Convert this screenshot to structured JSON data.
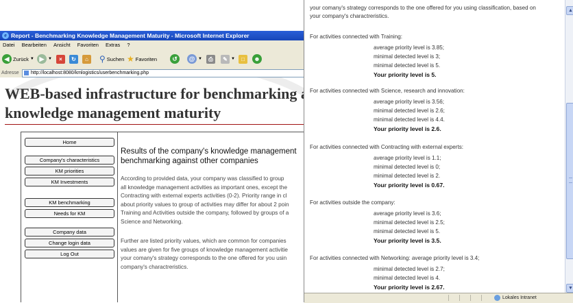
{
  "browser": {
    "title": "Report - Benchmarking Knowledge Management Maturity - Microsoft Internet Explorer",
    "menu": [
      "Datei",
      "Bearbeiten",
      "Ansicht",
      "Favoriten",
      "Extras",
      "?"
    ],
    "toolbar": {
      "back_label": "Zurück",
      "search_label": "Suchen",
      "favorites_label": "Favoriten"
    },
    "address": {
      "label": "Adresse",
      "url": "http://localhost:8080/kmlogistics/userbenchmarking.php"
    }
  },
  "site": {
    "title_line1": "WEB-based infrastructure for benchmarking a logisti",
    "title_line2": "knowledge management maturity"
  },
  "nav": {
    "home": "Home",
    "company_characteristics": "Company's characteristics",
    "km_priorities": "KM priorities",
    "km_investments": "KM Investments",
    "km_benchmarking": "KM benchmarking",
    "needs_for_km": "Needs for KM",
    "company_data": "Company data",
    "change_login": "Change login data",
    "log_out": "Log Out"
  },
  "main": {
    "heading_line1": "Results of the company's knowledge management",
    "heading_line2": "benchmarking against other companies",
    "p1": [
      "According to provided data, your company was classified to group",
      "all knowledge management activities as important ones, except the",
      "Contracting with external experts activities (0-2). Priority range in cl",
      "about priority values to group of activities may differ for about 2 poin",
      "Training and Activities outside the company, followed by groups of a",
      "Science and Networking."
    ],
    "p2": [
      "Further are listed priority values, which are common for companies",
      "values are given for five groups of knowledge management activitie",
      "your comany's strategy corresponds to the one offered for you usin",
      "company's charactreristics."
    ]
  },
  "popup": {
    "intro_line1": "your comany's strategy corresponds to the one offered for you using classification, based on",
    "intro_line2": "your company's charactreristics.",
    "groups": [
      {
        "heading": "For activities connected with Training:",
        "avg": "average priority level is 3.85;",
        "min": "minimal detected level is 3;",
        "max": "minimal detected level is 5.",
        "yours": "Your priority level is 5."
      },
      {
        "heading": "For activities connected with Science, research and innovation:",
        "avg": "average priority level is 3.56;",
        "min": "minimal detected level is 2.6;",
        "max": "minimal detected level is 4.4.",
        "yours": "Your priority level is 2.6."
      },
      {
        "heading": "For activities connected with Contracting with external experts:",
        "avg": "average priority level is 1.1;",
        "min": "minimal detected level is 0;",
        "max": "minimal detected level is 2.",
        "yours": "Your priority level is 0.67."
      },
      {
        "heading": "For activities outside the company:",
        "avg": "average priority level is 3.6;",
        "min": "minimal detected level is 2.5;",
        "max": "minimal detected level is 5.",
        "yours": "Your priority level is 3.5."
      }
    ],
    "last_group": {
      "heading": "For activities connected with Networking: average priority level is 3.4;",
      "min": "minimal detected level is 2.7;",
      "max": "minimal detected level is 4.",
      "yours": "Your priority level is 2.67."
    },
    "status_zone": "Lokales Intranet"
  }
}
